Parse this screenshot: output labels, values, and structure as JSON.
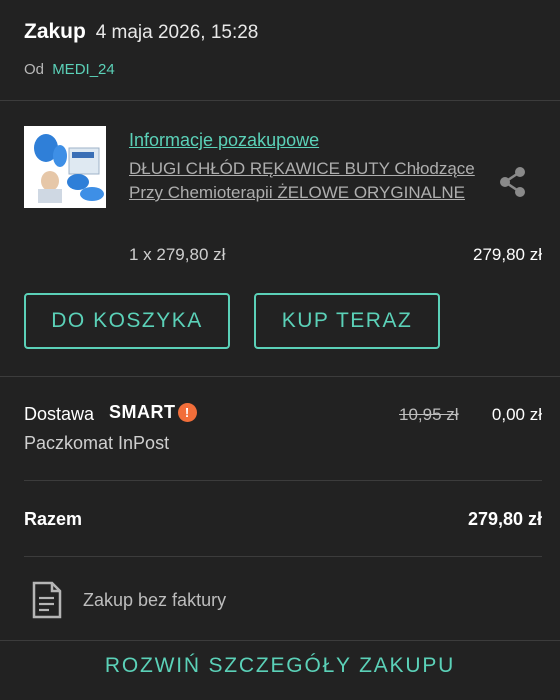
{
  "header": {
    "title": "Zakup",
    "date": "4 maja 2026, 15:28",
    "seller_prefix": "Od",
    "seller_name": "MEDI_24"
  },
  "item": {
    "info_link": "Informacje pozakupowe",
    "title": "DŁUGI CHŁÓD RĘKAWICE BUTY Chłodzące Przy Chemioterapii ŻELOWE ORYGINALNE",
    "quantity_text": "1 x 279,80 zł",
    "price": "279,80 zł",
    "share_icon": "share-icon"
  },
  "buttons": {
    "cart": "DO KOSZYKA",
    "buy": "KUP TERAZ"
  },
  "delivery": {
    "label": "Dostawa",
    "badge": "SMART",
    "badge_symbol": "!",
    "old_price": "10,95 zł",
    "new_price": "0,00 zł",
    "method": "Paczkomat InPost"
  },
  "total": {
    "label": "Razem",
    "value": "279,80 zł"
  },
  "invoice": {
    "text": "Zakup bez faktury",
    "icon": "document-icon"
  },
  "expand": {
    "label": "ROZWIŃ SZCZEGÓŁY ZAKUPU"
  },
  "colors": {
    "background": "#222222",
    "accent": "#5bd1b8",
    "smart_badge": "#f26e3a",
    "divider": "#3c3c3c"
  }
}
